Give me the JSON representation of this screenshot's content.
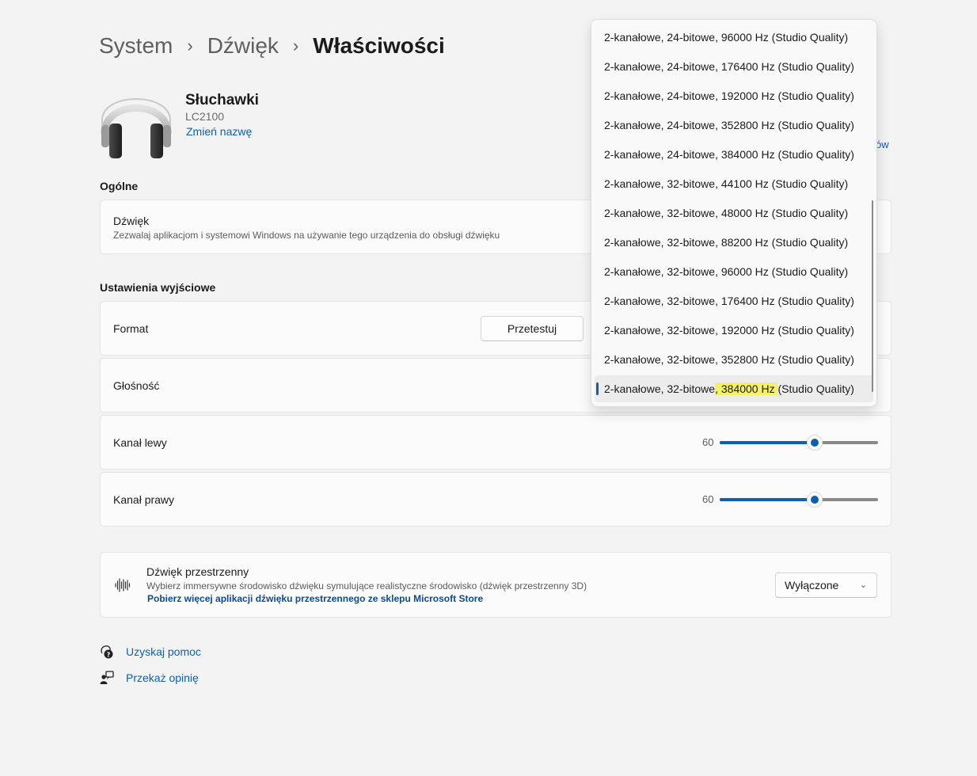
{
  "breadcrumb": {
    "items": [
      "System",
      "Dźwięk",
      "Właściwości"
    ],
    "separator": "›"
  },
  "device": {
    "name": "Słuchawki",
    "model": "LC2100",
    "rename_link": "Zmień nazwę",
    "partial_link_text": "ów"
  },
  "general": {
    "section_title": "Ogólne",
    "sound_card": {
      "title": "Dźwięk",
      "description": "Zezwalaj aplikacjom i systemowi Windows na używanie tego urządzenia do obsługi dźwięku"
    }
  },
  "output": {
    "section_title": "Ustawienia wyjściowe",
    "format": {
      "label": "Format",
      "test_button": "Przetestuj"
    },
    "volume": {
      "label": "Głośność"
    },
    "left_channel": {
      "label": "Kanał lewy",
      "value": "60",
      "level": 0.6
    },
    "right_channel": {
      "label": "Kanał prawy",
      "value": "60",
      "level": 0.6
    }
  },
  "spatial": {
    "title": "Dźwięk przestrzenny",
    "description": "Wybierz immersywne środowisko dźwięku symulujące realistyczne środowisko (dźwięk przestrzenny 3D)",
    "store_link": "Pobierz więcej aplikacji dźwięku przestrzennego ze sklepu Microsoft Store",
    "selected": "Wyłączone"
  },
  "footer": {
    "help": "Uzyskaj pomoc",
    "feedback": "Przekaż opinię"
  },
  "format_dropdown": {
    "options": [
      "2-kanałowe, 24-bitowe, 96000 Hz (Studio Quality)",
      "2-kanałowe, 24-bitowe, 176400 Hz (Studio Quality)",
      "2-kanałowe, 24-bitowe, 192000 Hz (Studio Quality)",
      "2-kanałowe, 24-bitowe, 352800 Hz (Studio Quality)",
      "2-kanałowe, 24-bitowe, 384000 Hz (Studio Quality)",
      "2-kanałowe, 32-bitowe, 44100 Hz (Studio Quality)",
      "2-kanałowe, 32-bitowe, 48000 Hz (Studio Quality)",
      "2-kanałowe, 32-bitowe, 88200 Hz (Studio Quality)",
      "2-kanałowe, 32-bitowe, 96000 Hz (Studio Quality)",
      "2-kanałowe, 32-bitowe, 176400 Hz (Studio Quality)",
      "2-kanałowe, 32-bitowe, 192000 Hz (Studio Quality)",
      "2-kanałowe, 32-bitowe, 352800 Hz (Studio Quality)"
    ],
    "selected_parts": {
      "before": "2-kanałowe, 32-bitowe",
      "highlight": ", 384000 Hz ",
      "after": "(Studio Quality)"
    },
    "highlight_color": "#f5f06a"
  },
  "colors": {
    "accent": "#0f5fb0",
    "background": "#f3f3f3"
  },
  "icons": {
    "headphones": "headphones-icon",
    "spatial": "soundwave-icon",
    "help": "help-icon",
    "feedback": "feedback-icon",
    "chevron": "chevron-down-icon"
  }
}
